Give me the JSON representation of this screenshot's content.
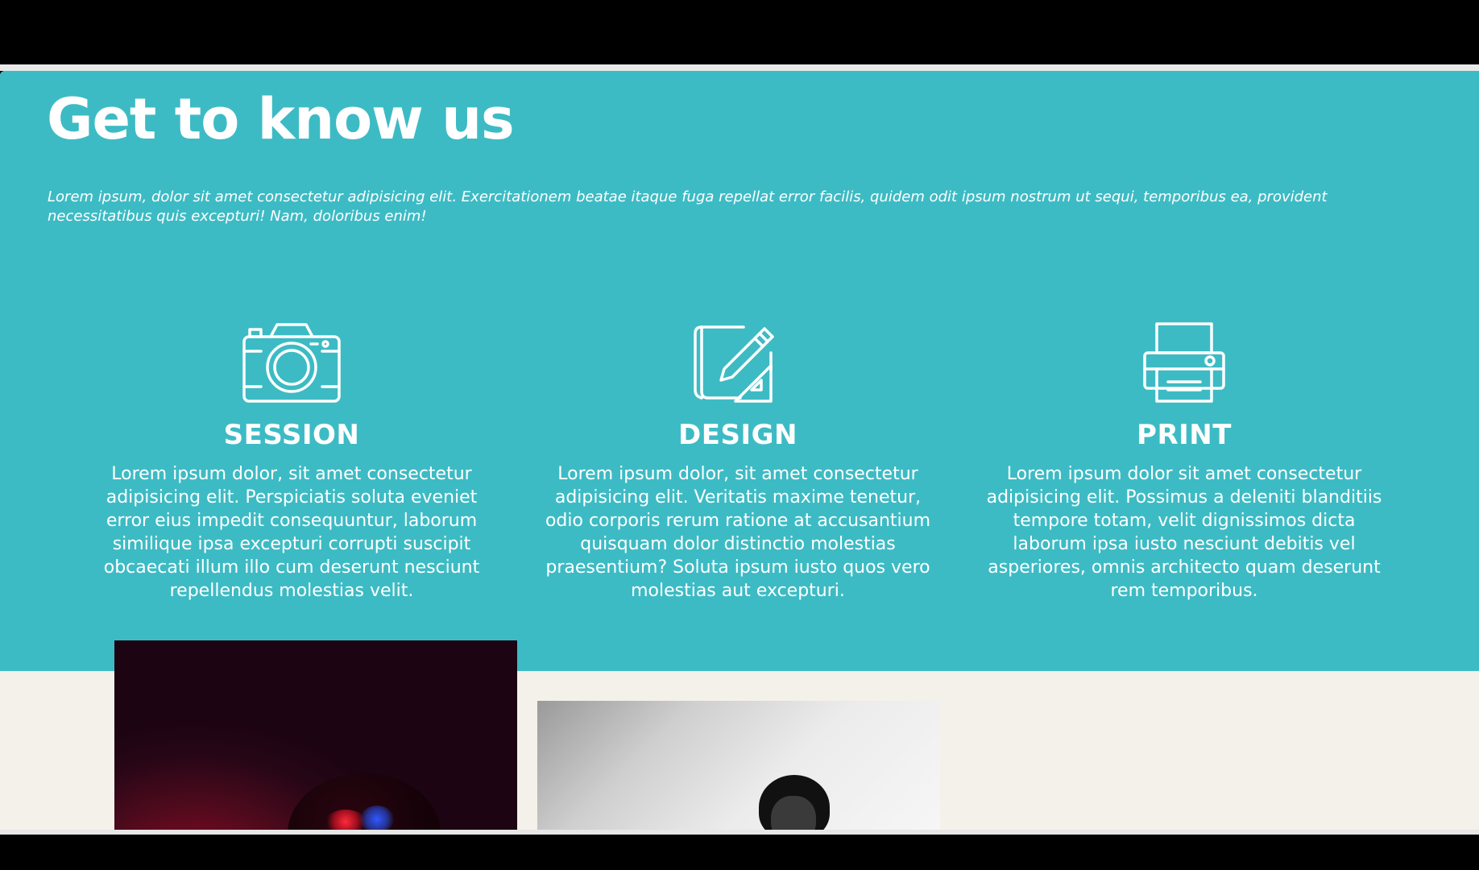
{
  "about": {
    "title": "Get to know us",
    "intro": "Lorem ipsum, dolor sit amet consectetur adipisicing elit. Exercitationem beatae itaque fuga repellat error facilis, quidem odit ipsum nostrum ut sequi, temporibus ea, provident necessitatibus quis excepturi! Nam, doloribus enim!",
    "services": [
      {
        "icon": "camera-icon",
        "title": "SESSION",
        "text": "Lorem ipsum dolor, sit amet consectetur adipisicing elit. Perspiciatis soluta eveniet error eius impedit consequuntur, laborum similique ipsa excepturi corrupti suscipit obcaecati illum illo cum deserunt nesciunt repellendus molestias velit."
      },
      {
        "icon": "design-blueprint-icon",
        "title": "DESIGN",
        "text": "Lorem ipsum dolor, sit amet consectetur adipisicing elit. Veritatis maxime tenetur, odio corporis rerum ratione at accusantium quisquam dolor distinctio molestias praesentium? Soluta ipsum iusto quos vero molestias aut excepturi."
      },
      {
        "icon": "printer-icon",
        "title": "PRINT",
        "text": "Lorem ipsum dolor sit amet consectetur adipisicing elit. Possimus a deleniti blanditiis tempore totam, velit dignissimos dicta laborum ipsa iusto nesciunt debitis vel asperiores, omnis architecto quam deserunt rem temporibus."
      }
    ]
  },
  "colors": {
    "section_background": "#3dbbc4",
    "page_background": "#f4f1ea",
    "text": "#ffffff"
  }
}
